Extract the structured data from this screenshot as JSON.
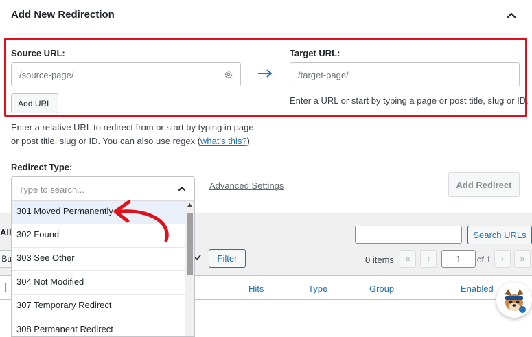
{
  "panel": {
    "title": "Add New Redirection"
  },
  "source": {
    "label": "Source URL:",
    "placeholder": "/source-page/",
    "add_button": "Add URL",
    "help_line1": "Enter a relative URL to redirect from or start by typing in page",
    "help_line2_prefix": "or post title, slug or ID. You can also use regex (",
    "help_link": "what's this?",
    "help_line2_suffix": ")"
  },
  "target": {
    "label": "Target URL:",
    "placeholder": "/target-page/",
    "help": "Enter a URL or start by typing a page or post title, slug or ID."
  },
  "redirect_type": {
    "label": "Redirect Type:",
    "search_placeholder": "Type to search...",
    "options": [
      "301 Moved Permanently",
      "302 Found",
      "303 See Other",
      "304 Not Modified",
      "307 Temporary Redirect",
      "308 Permanent Redirect"
    ]
  },
  "advanced_settings": "Advanced Settings",
  "add_redirect_button": "Add Redirect",
  "list": {
    "all_label": "All",
    "bulk_label": "Bu",
    "filter_button": "Filter",
    "search_button": "Search URLs",
    "items_count": "0 items",
    "first_page": "«",
    "prev_page": "‹",
    "page_value": "1",
    "of_pages": "of 1",
    "next_page": "›",
    "last_page": "»",
    "columns": [
      "Hits",
      "Type",
      "Group",
      "Enabled"
    ]
  },
  "colors": {
    "accent": "#2271b1",
    "highlight_red": "#e0101a"
  }
}
